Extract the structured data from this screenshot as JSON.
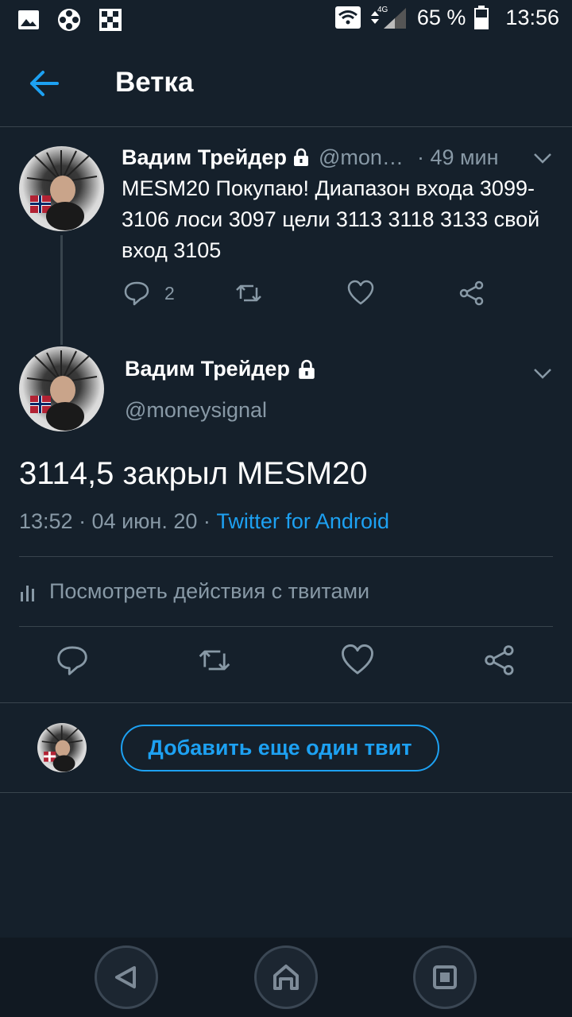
{
  "status_bar": {
    "battery": "65 %",
    "time": "13:56",
    "network": "4G"
  },
  "header": {
    "title": "Ветка"
  },
  "tweet1": {
    "name": "Вадим Трейдер",
    "handle": "@mon…",
    "time": "· 49 мин",
    "text": "MESM20 Покупаю! Диапазон входа 3099-3106 лоси 3097 цели 3113 3118 3133 свой вход 3105",
    "reply_count": "2"
  },
  "tweet2": {
    "name": "Вадим Трейдер",
    "handle": "@moneysignal",
    "text": "3114,5 закрыл MESM20",
    "timestamp": "13:52 · 04 июн. 20 · ",
    "source": "Twitter for Android",
    "activity_label": "Посмотреть действия с твитами"
  },
  "reply": {
    "button_label": "Добавить еще один твит"
  },
  "colors": {
    "background": "#15202b",
    "accent": "#1da1f2",
    "secondary_text": "#8899a6",
    "divider": "#38444d"
  },
  "icons": [
    "image-icon",
    "film-reel-icon",
    "checkerboard-icon",
    "wifi-icon",
    "signal-icon",
    "battery-icon",
    "back-arrow-icon",
    "lock-icon",
    "chevron-down-icon",
    "reply-icon",
    "retweet-icon",
    "like-icon",
    "share-icon",
    "bar-chart-icon",
    "nav-back-icon",
    "nav-home-icon",
    "nav-recents-icon"
  ]
}
